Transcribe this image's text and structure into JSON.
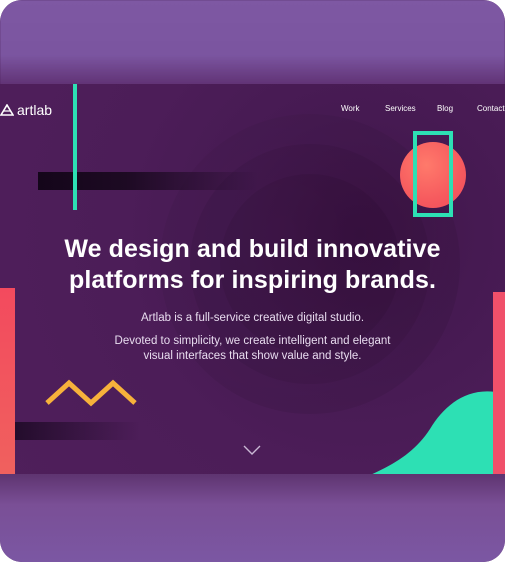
{
  "brand": {
    "name": "artlab"
  },
  "nav": {
    "items": [
      "Work",
      "Services",
      "Blog",
      "Contact"
    ]
  },
  "hero": {
    "headline_line1": "We design and build innovative",
    "headline_line2": "platforms for inspiring brands.",
    "tagline": "Artlab is a full-service creative digital studio.",
    "description_line1": "Devoted to simplicity, we create intelligent and elegant",
    "description_line2": "visual interfaces that show value and style."
  },
  "icons": {
    "logo": "artlab-logo-icon",
    "scroll": "chevron-down-icon",
    "zigzag": "zigzag-shape"
  },
  "colors": {
    "background": "#4a1d56",
    "teal": "#2de0b4",
    "coral": "#f65a5e",
    "yellow": "#f7b23b",
    "frame_glow": "#7b55a0"
  }
}
